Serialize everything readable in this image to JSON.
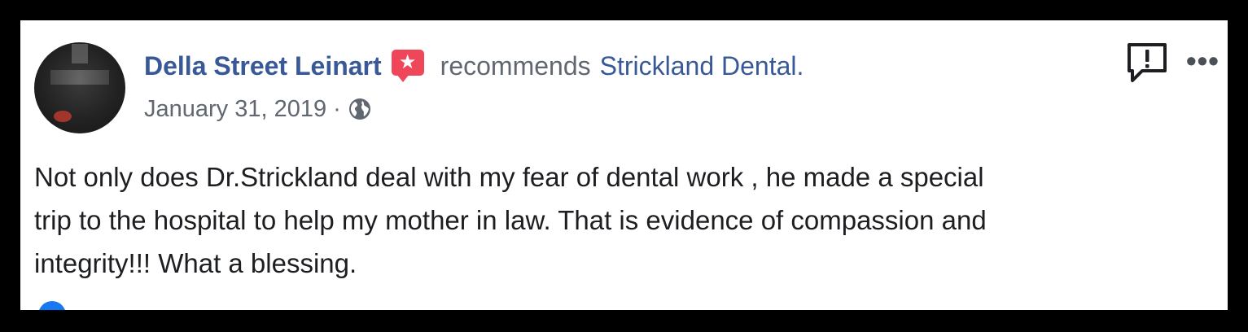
{
  "post": {
    "author": "Della Street Leinart",
    "action": "recommends",
    "business": "Strickland Dental.",
    "date": "January 31, 2019",
    "separator": "·",
    "privacy_icon": "globe-icon",
    "recommend_icon": "recommendation-star-icon",
    "body_lines": [
      "Not only does Dr.Strickland deal with my fear of dental work , he made a special",
      "trip to the hospital to help my mother in law. That is evidence of compassion and",
      "integrity!!! What a blessing."
    ]
  },
  "toolbar": {
    "report_icon": "report-icon",
    "more_icon": "more-options-icon",
    "more_glyph": "•••"
  },
  "colors": {
    "link_blue": "#385898",
    "secondary_gray": "#606770",
    "body_text": "#1c1e21",
    "recommend_red": "#f0465a",
    "frame_black": "#000000"
  }
}
